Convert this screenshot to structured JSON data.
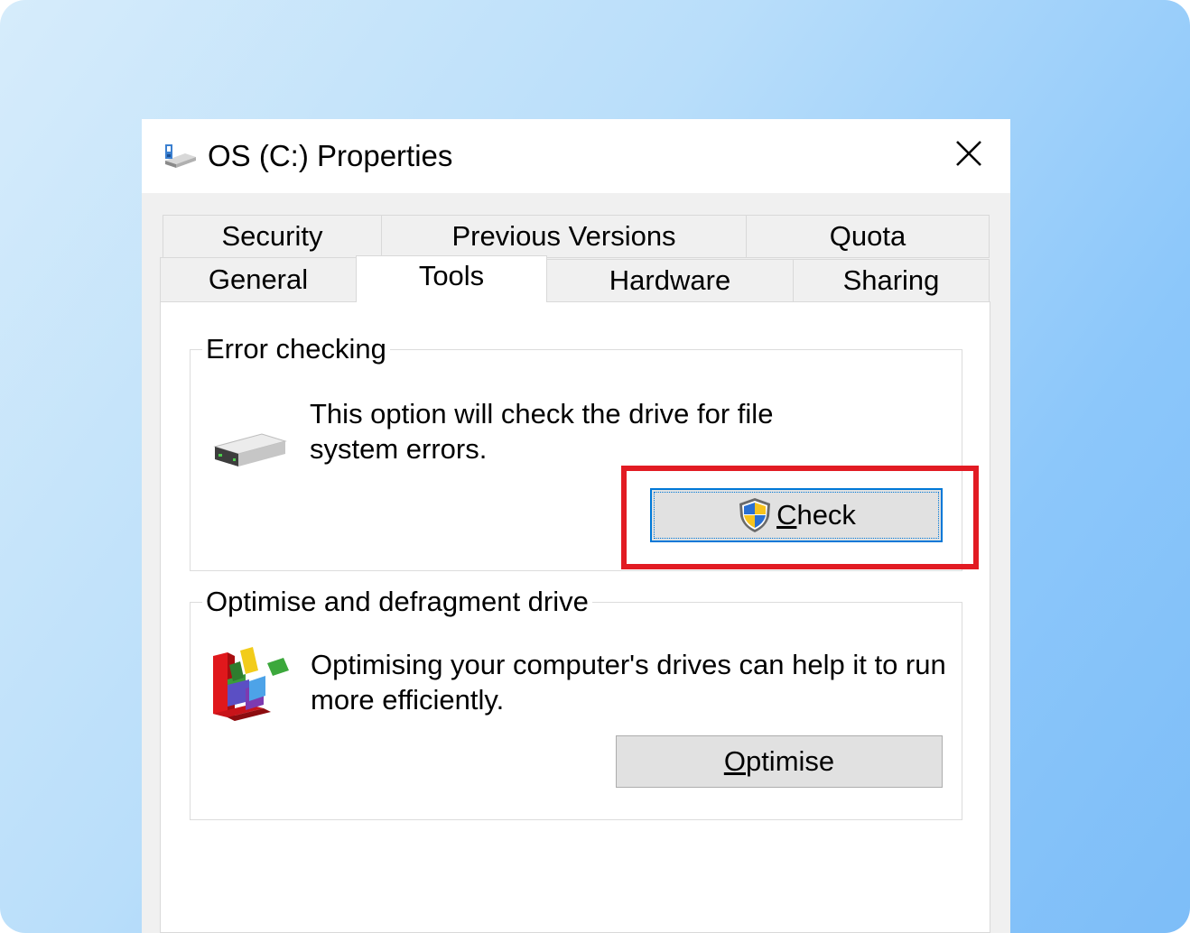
{
  "window": {
    "title": "OS (C:) Properties",
    "icon": "drive-icon",
    "close_icon": "close-icon"
  },
  "tabs": {
    "row1": [
      {
        "label": "Security"
      },
      {
        "label": "Previous Versions"
      },
      {
        "label": "Quota"
      }
    ],
    "row2": [
      {
        "label": "General"
      },
      {
        "label": "Tools",
        "active": true
      },
      {
        "label": "Hardware"
      },
      {
        "label": "Sharing"
      }
    ]
  },
  "error_checking": {
    "group_label": "Error checking",
    "description_line1": "This option will check the drive for file",
    "description_line2": "system errors.",
    "button_mnemonic": "C",
    "button_rest": "heck",
    "button_icon": "uac-shield-icon"
  },
  "optimise": {
    "group_label": "Optimise and defragment drive",
    "description_line1": "Optimising your computer's drives can help it to run",
    "description_line2": "more efficiently.",
    "button_mnemonic": "O",
    "button_rest": "ptimise",
    "icon": "defrag-icon"
  },
  "colors": {
    "highlight": "#e21b23",
    "focus": "#0078d7"
  }
}
